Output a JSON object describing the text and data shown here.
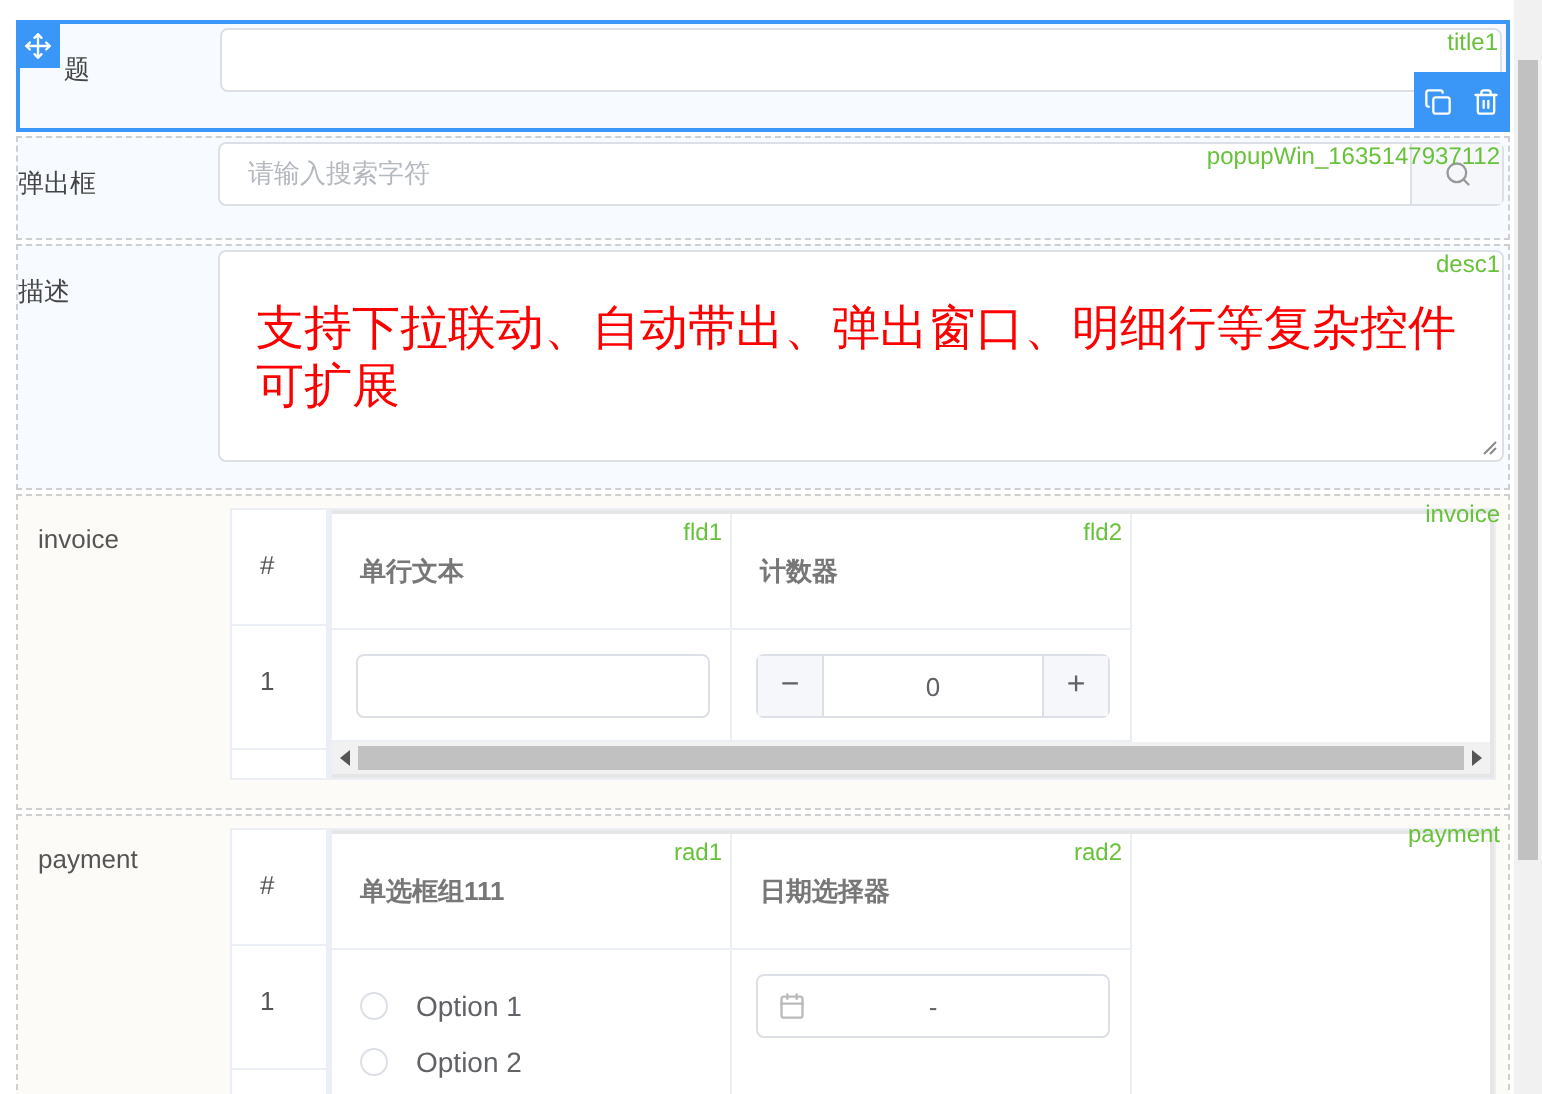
{
  "form_fields": [
    {
      "kind": "text",
      "label": "题",
      "field_id": "title1",
      "selected": true
    },
    {
      "kind": "popup",
      "label": "弹出框",
      "placeholder": "请输入搜索字符",
      "field_id": "popupWin_1635147937112",
      "selected": false
    },
    {
      "kind": "textarea",
      "label": "描述",
      "value": "支持下拉联动、自动带出、弹出窗口、明细行等复杂控件可扩展",
      "field_id": "desc1",
      "selected": false
    },
    {
      "kind": "subtable",
      "label": "invoice",
      "field_id": "invoice",
      "selected": false,
      "horizontal_scrollbar": true,
      "index_header": "#",
      "rows": [
        "1"
      ],
      "columns": [
        {
          "kind": "text",
          "header": "单行文本",
          "field_id": "fld1"
        },
        {
          "kind": "counter",
          "header": "计数器",
          "field_id": "fld2",
          "minus": "−",
          "value": "0",
          "plus": "+"
        }
      ]
    },
    {
      "kind": "subtable",
      "label": "payment",
      "field_id": "payment",
      "selected": false,
      "index_header": "#",
      "rows": [
        "1"
      ],
      "columns": [
        {
          "kind": "radio",
          "header": "单选框组111",
          "field_id": "rad1",
          "options": [
            {
              "label": "Option 1",
              "selected": false
            },
            {
              "label": "Option 2",
              "selected": false
            }
          ]
        },
        {
          "kind": "date",
          "header": "日期选择器",
          "field_id": "rad2",
          "value": "-"
        }
      ]
    }
  ]
}
